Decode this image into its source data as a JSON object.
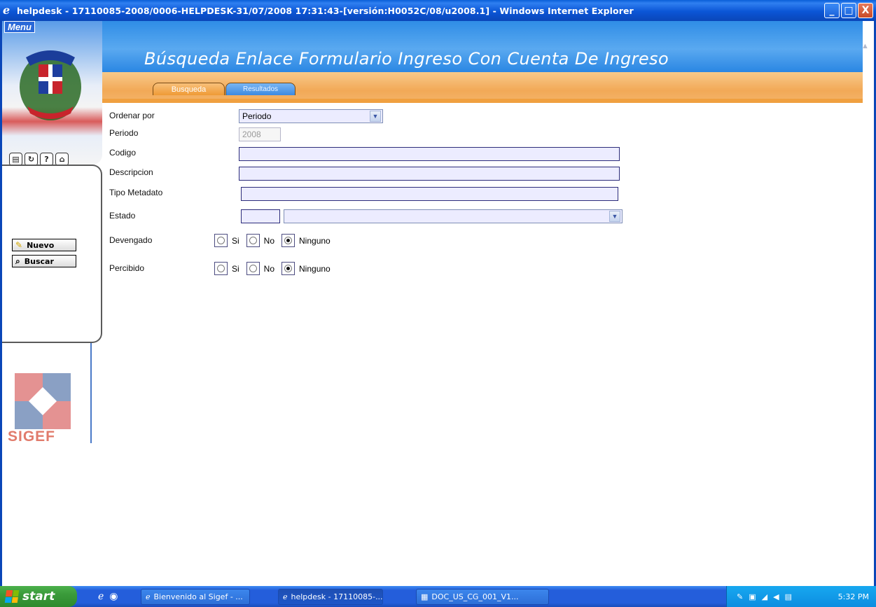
{
  "window": {
    "title": "helpdesk - 17110085-2008/0006-HELPDESK-31/07/2008 17:31:43-[versión:H0052C/08/u2008.1] - Windows Internet Explorer",
    "minimize": "_",
    "maximize": "□",
    "close": "X"
  },
  "sidebar": {
    "menu_label": "Menu",
    "new_label": "Nuevo",
    "search_label": "Buscar",
    "logo_text": "SIGEF"
  },
  "header": {
    "title": "Búsqueda Enlace Formulario Ingreso Con Cuenta De Ingreso",
    "tabs": [
      {
        "label": "Busqueda"
      },
      {
        "label": "Resultados"
      }
    ]
  },
  "form": {
    "ordenar_label": "Ordenar por",
    "ordenar_value": "Periodo",
    "periodo_label": "Periodo",
    "periodo_value": "2008",
    "codigo_label": "Codigo",
    "codigo_value": "",
    "descripcion_label": "Descripcion",
    "descripcion_value": "",
    "tipo_label": "Tipo Metadato",
    "tipo_value": "",
    "estado_label": "Estado",
    "estado_code": "",
    "estado_value": "",
    "devengado_label": "Devengado",
    "percibido_label": "Percibido",
    "options": {
      "si": "Si",
      "no": "No",
      "ninguno": "Ninguno"
    },
    "devengado_selected": "Ninguno",
    "percibido_selected": "Ninguno"
  },
  "taskbar": {
    "start_label": "start",
    "tasks": [
      {
        "label": "Bienvenido al Sigef - ..."
      },
      {
        "label": "helpdesk - 17110085-..."
      },
      {
        "label": "DOC_US_CG_001_V1..."
      }
    ],
    "clock": "5:32 PM"
  },
  "colors": {
    "header_blue": "#2f8de6",
    "tabs_orange": "#f2a957",
    "input_fill": "#ececff",
    "titlebar_blue": "#0b55d6"
  }
}
